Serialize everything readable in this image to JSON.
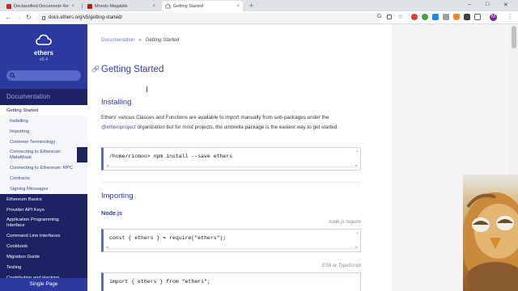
{
  "browser": {
    "tabs": [
      {
        "title": "Declassified Documents Reveal...",
        "favicon_color": "#c62828"
      },
      {
        "title": "Mondo Megabits",
        "favicon_color": "#b71c1c"
      },
      {
        "title": "Getting Started",
        "favicon_color": "#5f6368"
      }
    ],
    "url": "docs.ethers.org/v5/getting-started/",
    "profile_initial": "M"
  },
  "sidebar": {
    "title": "ethers",
    "version": "v5.4",
    "section_heading": "Documentation",
    "items": [
      {
        "label": "Getting Started",
        "state": "active"
      },
      {
        "label": "Installing",
        "state": "sub"
      },
      {
        "label": "Importing",
        "state": "sub"
      },
      {
        "label": "Common Terminology",
        "state": "sub"
      },
      {
        "label": "Connecting to Ethereum: MetaMask",
        "state": "sub"
      },
      {
        "label": "Connecting to Ethereum: RPC",
        "state": "sub"
      },
      {
        "label": "Contracts",
        "state": "sub"
      },
      {
        "label": "Signing Messages",
        "state": "sub"
      },
      {
        "label": "Ethereum Basics",
        "state": "top"
      },
      {
        "label": "Provider API Keys",
        "state": "top"
      },
      {
        "label": "Application Programming Interface",
        "state": "top"
      },
      {
        "label": "Command Line Interfaces",
        "state": "top"
      },
      {
        "label": "Cookbook",
        "state": "top"
      },
      {
        "label": "Migration Guide",
        "state": "top"
      },
      {
        "label": "Testing",
        "state": "top"
      },
      {
        "label": "Contributing and Hacking",
        "state": "top"
      }
    ],
    "single_page": "Single Page"
  },
  "content": {
    "breadcrumb_root": "Documentation",
    "breadcrumb_sep": "»",
    "breadcrumb_current": "Getting Started",
    "title": "Getting Started",
    "installing": {
      "heading": "Installing",
      "para_before": "Ethers' various Classes and Functions are available to import manually from sub-packages under the ",
      "para_link": "@ethersproject",
      "para_after": " organization but for most projects, the umbrella package is the easiest way to get started.",
      "code": "/home/ricmoo> npm install --save ethers"
    },
    "importing": {
      "heading": "Importing",
      "node_heading": "Node.js",
      "node_label": "node.js require",
      "node_code": "const { ethers } = require(\"ethers\");",
      "es6_label": "ES6 or TypeScript",
      "es6_code": "import { ethers } from \"ethers\";"
    }
  },
  "colors": {
    "sidebar_bg": "#1c2262",
    "sidebar_header": "#2c3a9e",
    "accent": "#2f3e9e",
    "link": "#3f51b5"
  }
}
